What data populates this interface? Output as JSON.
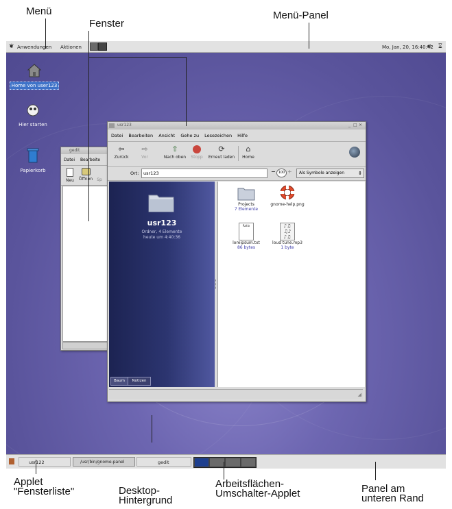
{
  "annotations": {
    "menu": "Menü",
    "window": "Fenster",
    "menu_panel": "Menü-Panel",
    "window_list_applet_line1": "Applet",
    "window_list_applet_line2": "\"Fensterliste\"",
    "desktop_bg_line1": "Desktop-",
    "desktop_bg_line2": "Hintergrund",
    "workspace_switcher_line1": "Arbeitsflächen-",
    "workspace_switcher_line2": "Umschalter-Applet",
    "bottom_panel_line1": "Panel am",
    "bottom_panel_line2": "unteren Rand"
  },
  "top_panel": {
    "applications": "Anwendungen",
    "actions": "Aktionen",
    "clock": "Mo, Jan, 20, 16:40:42"
  },
  "desktop_icons": [
    {
      "label": "Home von user123",
      "icon": "home-icon"
    },
    {
      "label": "Hier starten",
      "icon": "start-here-icon"
    },
    {
      "label": "Papierkorb",
      "icon": "trash-icon"
    }
  ],
  "gedit": {
    "title": "gedit",
    "menu": [
      "Datei",
      "Bearbeite"
    ],
    "toolbar": [
      "Neu",
      "Öffnen",
      "Sp"
    ]
  },
  "nautilus": {
    "title": "usr123",
    "menu": [
      "Datei",
      "Bearbeiten",
      "Ansicht",
      "Gehe zu",
      "Lesezeichen",
      "Hilfe"
    ],
    "toolbar": [
      "Zurück",
      "Vor",
      "Nach oben",
      "Stopp",
      "Erneut laden",
      "Home"
    ],
    "location_label": "Ort:",
    "location_value": "usr123",
    "zoom": "100",
    "view_mode": "Als Symbole anzeigen",
    "side": {
      "name": "usr123",
      "info": "Ordner, 4 Elemente",
      "date": "heute um 4:40:36"
    },
    "tabs": [
      "Baum",
      "Notizen"
    ],
    "files": [
      {
        "name": "Projects",
        "sub": "7 Elemente",
        "icon": "folder-icon"
      },
      {
        "name": "gnome-help.png",
        "sub": "",
        "icon": "lifebuoy-icon"
      },
      {
        "name": "loreipsum.txt",
        "sub": "86 bytes",
        "icon": "text-file-icon",
        "preview": "Ratio"
      },
      {
        "name": "loud tune.mp3",
        "sub": "1 byte",
        "icon": "audio-file-icon"
      }
    ]
  },
  "bottom_panel": {
    "tasks": [
      "usr122",
      "/usr/bin/gnome-panel",
      "gedit"
    ]
  }
}
